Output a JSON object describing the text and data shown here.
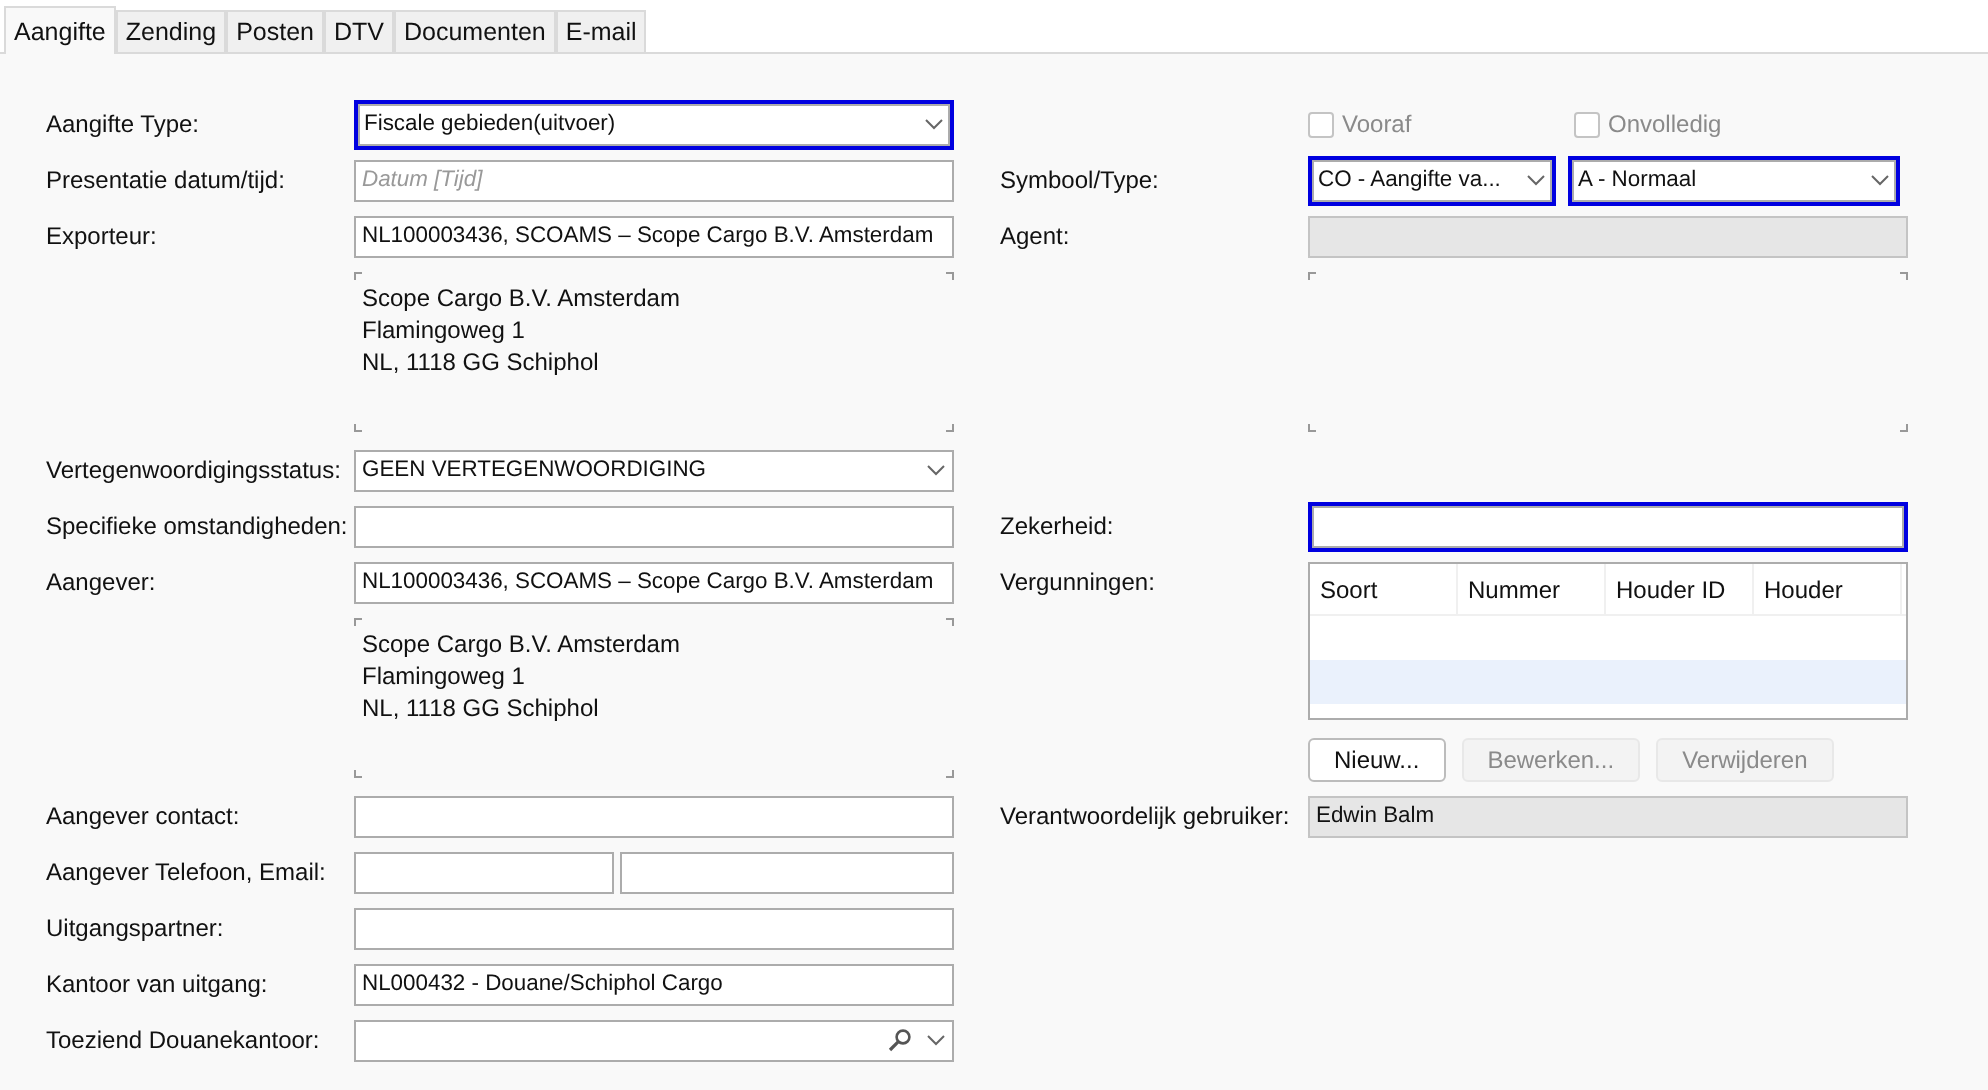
{
  "tabs": [
    {
      "label": "Aangifte",
      "selected": true
    },
    {
      "label": "Zending",
      "selected": false
    },
    {
      "label": "Posten",
      "selected": false
    },
    {
      "label": "DTV",
      "selected": false
    },
    {
      "label": "Documenten",
      "selected": false
    },
    {
      "label": "E-mail",
      "selected": false
    }
  ],
  "left": [
    {
      "kind": "select",
      "label": "Aangifte Type:",
      "value": "Fiscale gebieden(uitvoer)",
      "highlighted": true
    },
    {
      "kind": "input",
      "label": "Presentatie datum/tijd:",
      "placeholder": "Datum [Tijd]",
      "highlighted": false,
      "disabled": false
    },
    {
      "kind": "input",
      "label": "Exporteur:",
      "value": "NL100003436, SCOAMS – Scope Cargo B.V. Amsterdam",
      "highlighted": false,
      "disabled": false
    },
    {
      "kind": "address",
      "lines": [
        "Scope Cargo B.V. Amsterdam",
        "Flamingoweg 1",
        "NL, 1118 GG Schiphol"
      ]
    },
    {
      "kind": "select",
      "label": "Vertegenwoordigingsstatus:",
      "value": "GEEN VERTEGENWOORDIGING",
      "highlighted": false
    },
    {
      "kind": "input",
      "label": "Specifieke omstandigheden:",
      "highlighted": false,
      "disabled": false
    },
    {
      "kind": "input",
      "label": "Aangever:",
      "value": "NL100003436, SCOAMS – Scope Cargo B.V. Amsterdam",
      "highlighted": false,
      "disabled": false
    },
    {
      "kind": "address",
      "lines": [
        "Scope Cargo B.V. Amsterdam",
        "Flamingoweg 1",
        "NL, 1118 GG Schiphol"
      ]
    },
    {
      "kind": "input",
      "label": "Aangever contact:",
      "highlighted": false,
      "disabled": false
    },
    {
      "kind": "pair",
      "label": "Aangever Telefoon, Email:"
    },
    {
      "kind": "input",
      "label": "Uitgangspartner:",
      "highlighted": false,
      "disabled": false
    },
    {
      "kind": "input",
      "label": "Kantoor van uitgang:",
      "value": "NL000432 - Douane/Schiphol Cargo",
      "highlighted": false,
      "disabled": false
    },
    {
      "kind": "lookup",
      "label": "Toeziend Douanekantoor:"
    }
  ],
  "right": [
    {
      "kind": "checkboxes",
      "items": [
        {
          "label": "Vooraf",
          "checked": false,
          "disabled": true
        },
        {
          "label": "Onvolledig",
          "checked": false,
          "disabled": true
        }
      ]
    },
    {
      "kind": "select_pair",
      "label": "Symbool/Type:",
      "values": [
        "CO - Aangifte va...",
        "A - Normaal"
      ],
      "highlighted": true
    },
    {
      "kind": "input",
      "label": "Agent:",
      "highlighted": false,
      "disabled": true
    },
    {
      "kind": "address"
    },
    {
      "kind": "input",
      "label": "Zekerheid:",
      "highlighted": true,
      "disabled": false
    },
    {
      "kind": "table",
      "label": "Vergunningen:",
      "columns": [
        "Soort",
        "Nummer",
        "Houder ID",
        "Houder"
      ],
      "buttons": [
        {
          "label": "Nieuw...",
          "disabled": false
        },
        {
          "label": "Bewerken...",
          "disabled": true
        },
        {
          "label": "Verwijderen",
          "disabled": true
        }
      ]
    },
    {
      "kind": "input",
      "label": "Verantwoordelijk gebruiker:",
      "value": "Edwin Balm",
      "highlighted": false,
      "disabled": true
    }
  ]
}
